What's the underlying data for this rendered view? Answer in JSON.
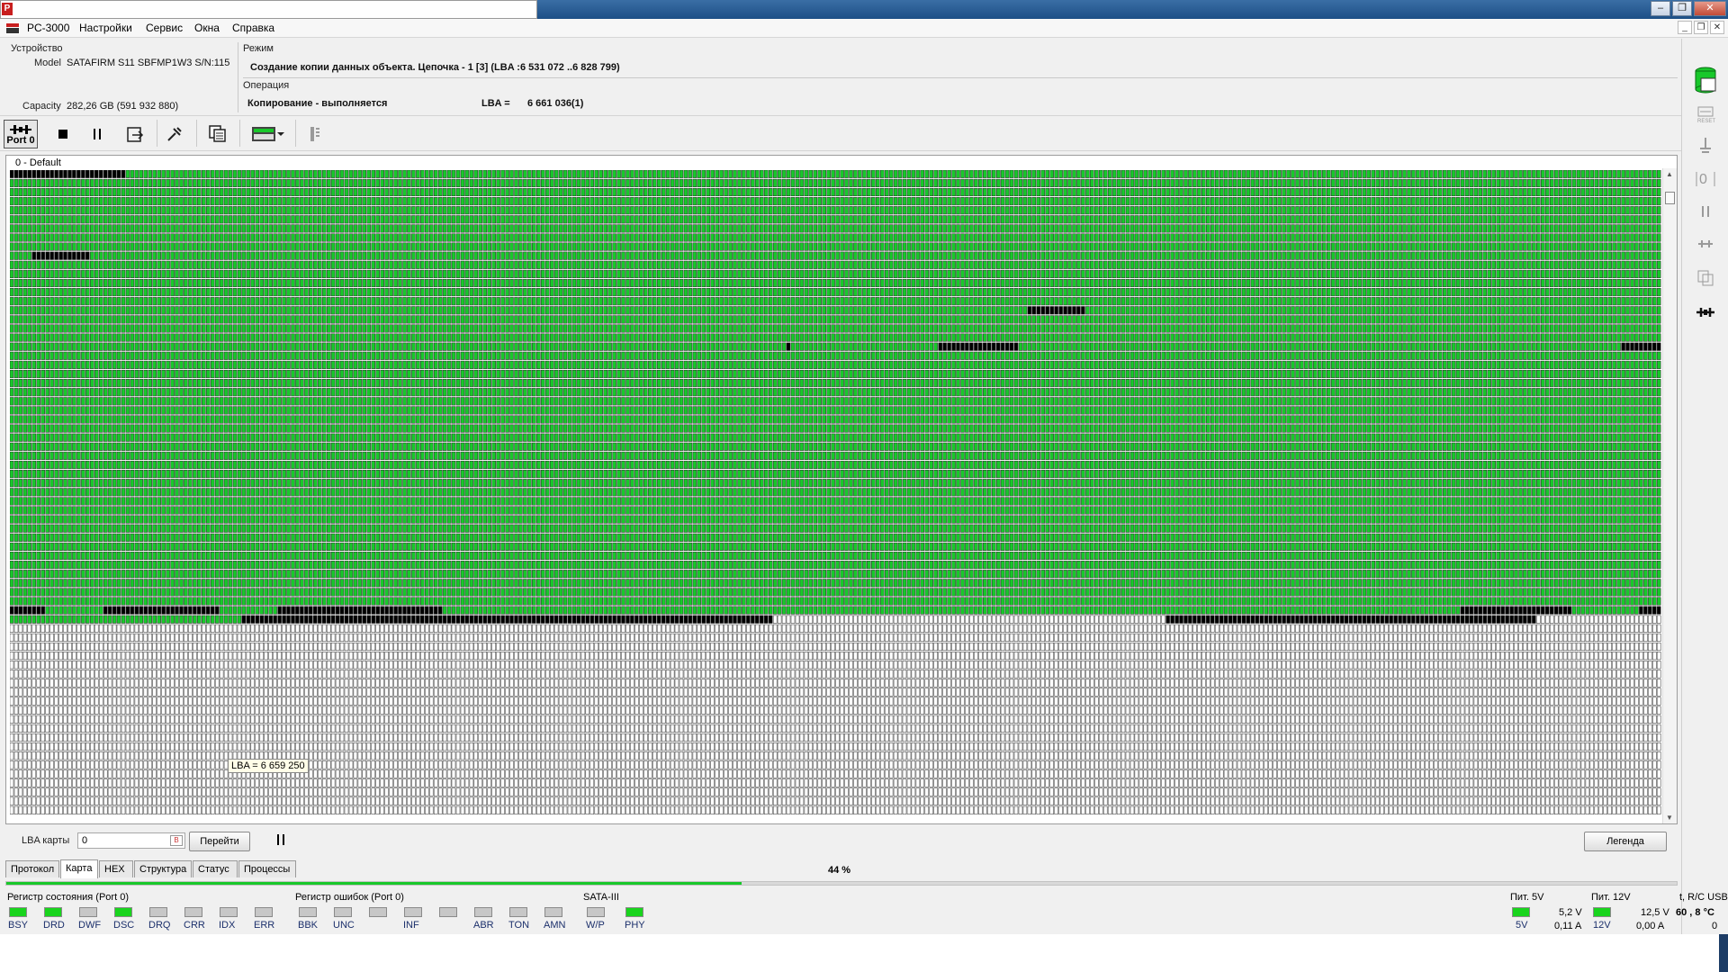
{
  "window": {
    "title": "",
    "app_name": "PC-3000"
  },
  "menu": [
    "PC-3000",
    "Настройки",
    "Сервис",
    "Окна",
    "Справка"
  ],
  "device": {
    "section_label": "Устройство",
    "model_label": "Model",
    "model_value": "SATAFIRM   S11 SBFMP1W3 S/N:115",
    "capacity_label": "Capacity",
    "capacity_value": "282,26 GB (591 932 880)"
  },
  "mode": {
    "label": "Режим",
    "value": "Создание копии данных объекта. Цепочка - 1 [3] (LBA :6 531 072 ..6 828 799)"
  },
  "operation": {
    "label": "Операция",
    "value": "Копирование - выполняется",
    "lba_label": "LBA =",
    "lba_value": "6 661 036(1)"
  },
  "toolbar": {
    "port_label": "Port 0"
  },
  "map": {
    "title": "0 - Default",
    "tooltip": "LBA =  6 659 250",
    "colors": {
      "read": "#18c82a",
      "bad": "#000000",
      "empty": "#ffffff"
    }
  },
  "controls": {
    "lba_label": "LBA карты",
    "lba_value": "0",
    "go_button": "Перейти",
    "legend_button": "Легенда"
  },
  "tabs": [
    "Протокол",
    "Карта",
    "HEX",
    "Структура",
    "Статус",
    "Процессы"
  ],
  "progress": {
    "label": "44 %",
    "value": 0.44
  },
  "status_register": {
    "title": "Регистр состояния (Port 0)",
    "items": [
      {
        "name": "BSY",
        "on": true
      },
      {
        "name": "DRD",
        "on": true
      },
      {
        "name": "DWF",
        "on": false
      },
      {
        "name": "DSC",
        "on": true
      },
      {
        "name": "DRQ",
        "on": false
      },
      {
        "name": "CRR",
        "on": false
      },
      {
        "name": "IDX",
        "on": false
      },
      {
        "name": "ERR",
        "on": false
      }
    ]
  },
  "error_register": {
    "title": "Регистр ошибок  (Port 0)",
    "items": [
      {
        "name": "BBK",
        "on": false
      },
      {
        "name": "UNC",
        "on": false
      },
      {
        "name": "",
        "on": false
      },
      {
        "name": "INF",
        "on": false
      },
      {
        "name": "",
        "on": false
      },
      {
        "name": "ABR",
        "on": false
      },
      {
        "name": "TON",
        "on": false
      },
      {
        "name": "AMN",
        "on": false
      }
    ]
  },
  "sata": {
    "title": "SATA-III",
    "items": [
      {
        "name": "W/P",
        "on": false
      },
      {
        "name": "PHY",
        "on": true
      }
    ]
  },
  "power5": {
    "title": "Пит. 5V",
    "led": "5V",
    "voltage": "5,2 V",
    "current": "0,11 A"
  },
  "power12": {
    "title": "Пит. 12V",
    "led": "12V",
    "voltage": "12,5 V",
    "current": "0,00 A"
  },
  "temp": {
    "title": "t, R/C USB",
    "value": "60 , 8 °C",
    "extra": "0"
  }
}
